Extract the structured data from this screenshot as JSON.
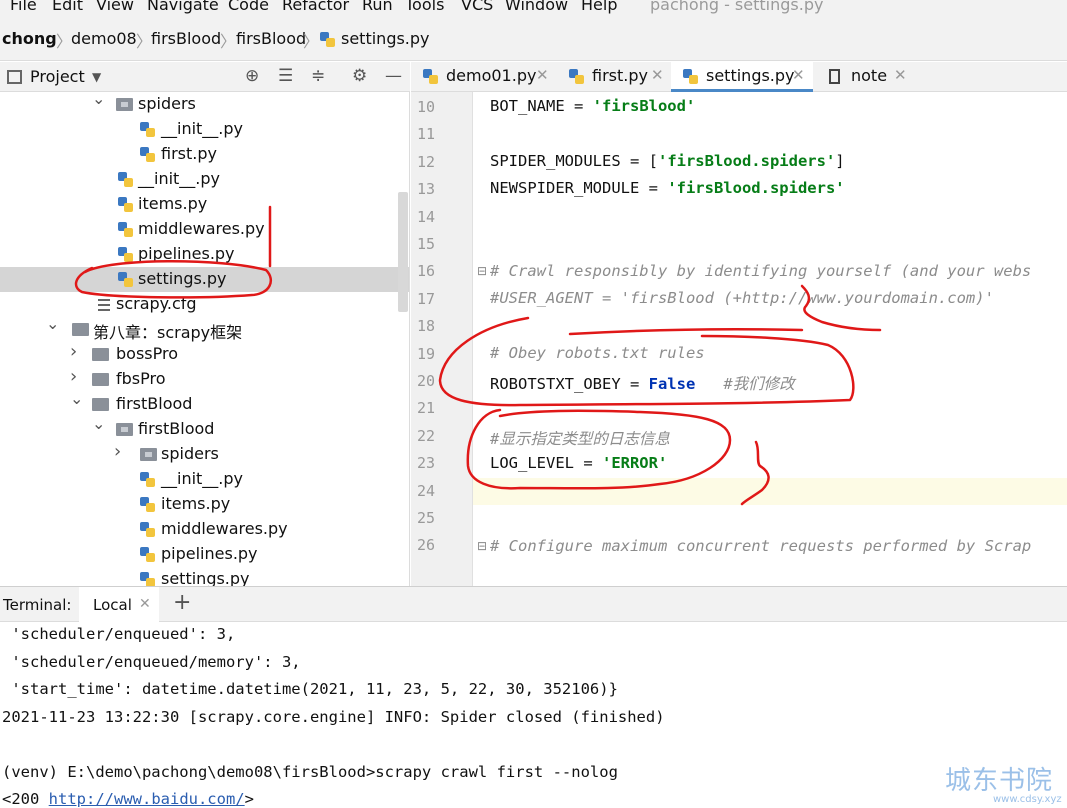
{
  "menu": {
    "items": [
      "File",
      "Edit",
      "View",
      "Navigate",
      "Code",
      "Refactor",
      "Run",
      "Tools",
      "VCS",
      "Window",
      "Help"
    ],
    "window_title": "pachong - settings.py"
  },
  "breadcrumb": [
    "chong",
    "demo08",
    "firsBlood",
    "firsBlood",
    "settings.py"
  ],
  "project_panel": {
    "title": "Project",
    "tree": [
      {
        "label": "spiders",
        "kind": "package",
        "arrow": "⌄"
      },
      {
        "label": "__init__.py",
        "kind": "py"
      },
      {
        "label": "first.py",
        "kind": "py"
      },
      {
        "label": "__init__.py",
        "kind": "py"
      },
      {
        "label": "items.py",
        "kind": "py"
      },
      {
        "label": "middlewares.py",
        "kind": "py"
      },
      {
        "label": "pipelines.py",
        "kind": "py"
      },
      {
        "label": "settings.py",
        "kind": "py",
        "selected": true
      },
      {
        "label": "scrapy.cfg",
        "kind": "cfg"
      },
      {
        "label": "第八章：scrapy框架",
        "kind": "folder",
        "arrow": "⌄"
      },
      {
        "label": "bossPro",
        "kind": "folder",
        "arrow": "›"
      },
      {
        "label": "fbsPro",
        "kind": "folder",
        "arrow": "›"
      },
      {
        "label": "firstBlood",
        "kind": "folder",
        "arrow": "⌄"
      },
      {
        "label": "firstBlood",
        "kind": "package",
        "arrow": "⌄"
      },
      {
        "label": "spiders",
        "kind": "package",
        "arrow": "›"
      },
      {
        "label": "__init__.py",
        "kind": "py"
      },
      {
        "label": "items.py",
        "kind": "py"
      },
      {
        "label": "middlewares.py",
        "kind": "py"
      },
      {
        "label": "pipelines.py",
        "kind": "py"
      },
      {
        "label": "settings.py",
        "kind": "py"
      }
    ]
  },
  "editor": {
    "tabs": [
      {
        "label": "demo01.py",
        "icon": "python-file-icon",
        "active": false
      },
      {
        "label": "first.py",
        "icon": "python-file-icon",
        "active": false
      },
      {
        "label": "settings.py",
        "icon": "python-file-icon",
        "active": true
      },
      {
        "label": "note",
        "icon": "text-file-icon",
        "active": false
      }
    ],
    "line_numbers": [
      "10",
      "11",
      "12",
      "13",
      "14",
      "15",
      "16",
      "17",
      "18",
      "19",
      "20",
      "21",
      "22",
      "23",
      "24",
      "25",
      "26"
    ],
    "code": {
      "l10_name": "BOT_NAME = ",
      "l10_val": "'firsBlood'",
      "l12_name": "SPIDER_MODULES = [",
      "l12_val": "'firsBlood.spiders'",
      "l12_end": "]",
      "l13_name": "NEWSPIDER_MODULE = ",
      "l13_val": "'firsBlood.spiders'",
      "l16": "# Crawl responsibly by identifying yourself (and your webs",
      "l17": "#USER_AGENT = 'firsBlood (+http://www.yourdomain.com)'",
      "l19": "# Obey robots.txt rules",
      "l20_name": "ROBOTSTXT_OBEY = ",
      "l20_val": "False",
      "l20_cm": "#我们修改",
      "l22": "#显示指定类型的日志信息",
      "l23_name": "LOG_LEVEL = ",
      "l23_val": "'ERROR'",
      "l26": "# Configure maximum concurrent requests performed by Scrap"
    }
  },
  "terminal": {
    "label": "Terminal:",
    "tab": "Local",
    "lines": [
      " 'scheduler/enqueued': 3,",
      " 'scheduler/enqueued/memory': 3,",
      " 'start_time': datetime.datetime(2021, 11, 23, 5, 22, 30, 352106)}",
      "2021-11-23 13:22:30 [scrapy.core.engine] INFO: Spider closed (finished)",
      "",
      "(venv) E:\\demo\\pachong\\demo08\\firsBlood>scrapy crawl first --nolog"
    ],
    "last_prefix": "<200 ",
    "last_link": "http://www.baidu.com/",
    "last_suffix": ">"
  },
  "watermark": {
    "text": "城东书院",
    "url": "www.cdsy.xyz"
  },
  "annotations": {
    "color": "#e01818"
  }
}
